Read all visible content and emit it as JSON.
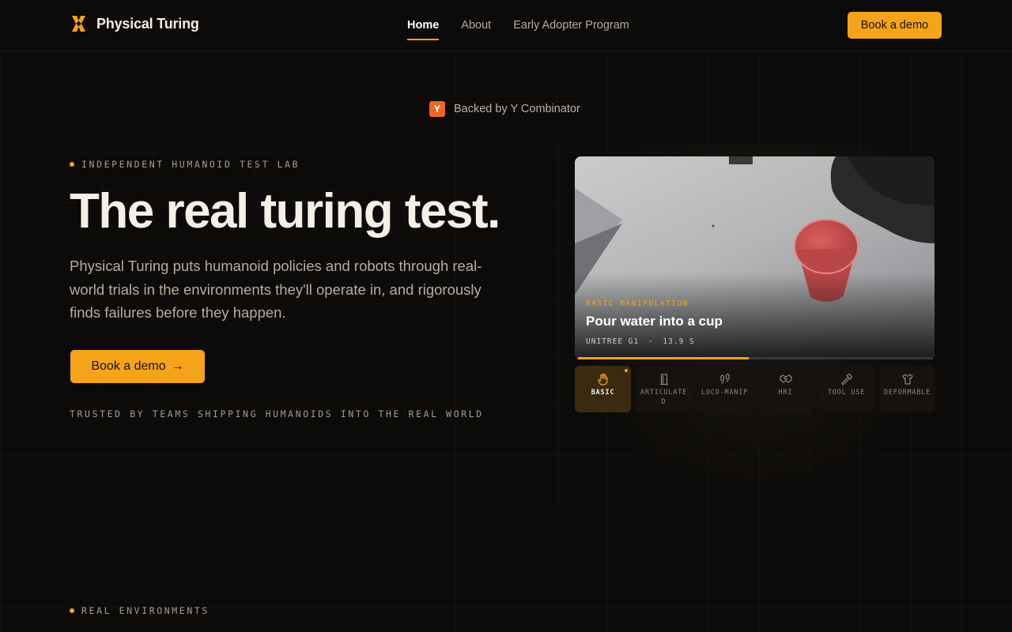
{
  "nav": {
    "brand": "Physical Turing",
    "links": [
      {
        "label": "Home",
        "active": true
      },
      {
        "label": "About",
        "active": false
      },
      {
        "label": "Early Adopter Program",
        "active": false
      }
    ],
    "cta": "Book a demo"
  },
  "yc": {
    "badge": "Y",
    "text": "Backed by Y Combinator"
  },
  "hero": {
    "eyebrow": "INDEPENDENT HUMANOID TEST LAB",
    "title": "The real turing test.",
    "subtitle": "Physical Turing puts humanoid policies and robots through real-world trials in the environments they'll operate in, and rigorously finds failures before they happen.",
    "cta": "Book a demo",
    "cta_arrow": "→",
    "trusted": "TRUSTED BY TEAMS SHIPPING HUMANOIDS INTO THE REAL WORLD"
  },
  "demo": {
    "category": "BASIC MANIPULATION",
    "title": "Pour water into a cup",
    "robot": "UNITREE G1",
    "separator": "·",
    "duration": "13.9 S",
    "progress": 0.48,
    "tabs": [
      {
        "label": "BASIC",
        "icon": "hand-icon",
        "active": true
      },
      {
        "label": "ARTICULATED",
        "icon": "door-icon",
        "active": false
      },
      {
        "label": "LOCO-MANIP",
        "icon": "footprints-icon",
        "active": false
      },
      {
        "label": "HRI",
        "icon": "handshake-icon",
        "active": false
      },
      {
        "label": "TOOL USE",
        "icon": "hammer-icon",
        "active": false
      },
      {
        "label": "DEFORMABLE",
        "icon": "shirt-icon",
        "active": false
      }
    ]
  },
  "section2": {
    "eyebrow": "REAL ENVIRONMENTS"
  },
  "colors": {
    "accent": "#f5a318",
    "background": "#0d0b09"
  }
}
